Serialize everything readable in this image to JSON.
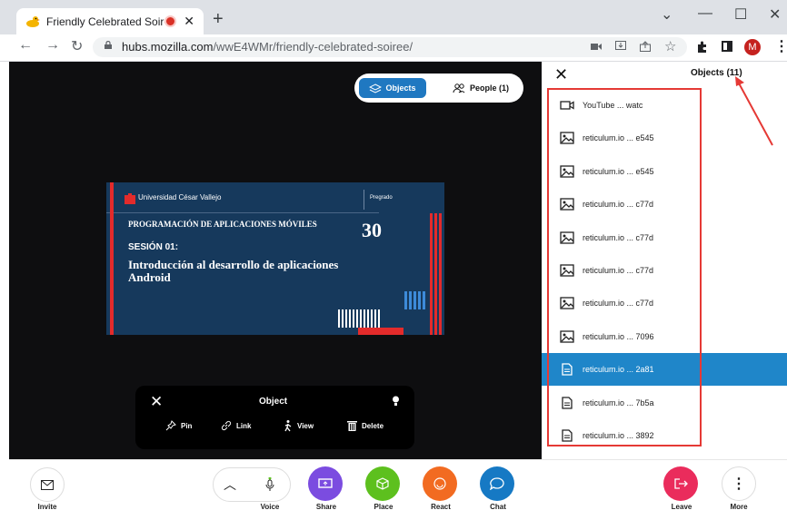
{
  "browser": {
    "tab_title": "Friendly Celebrated Soiree | ",
    "tab_close": "✕",
    "new_tab": "+",
    "win_minimize": "—",
    "win_maximize": "☐",
    "win_close": "✕",
    "url_domain": "hubs.mozilla.com",
    "url_path": "/wwE4WMr/friendly-celebrated-soiree/",
    "avatar_letter": "M"
  },
  "toggle": {
    "objects_label": "Objects",
    "people_label": "People (1)"
  },
  "slide": {
    "university": "Universidad César Vallejo",
    "program": "Pregrado",
    "course": "PROGRAMACIÓN DE APLICACIONES MÓVILES",
    "anniv": "30",
    "session": "SESIÓN 01:",
    "intro": "Introducción al desarrollo de aplicaciones Android"
  },
  "object_menu": {
    "title": "Object",
    "actions": [
      "Pin",
      "Link",
      "View",
      "Delete"
    ]
  },
  "panel": {
    "title": "Objects (11)",
    "items": [
      {
        "label": "YouTube ... watc",
        "icon": "video-icon"
      },
      {
        "label": "reticulum.io ... e545",
        "icon": "image-icon"
      },
      {
        "label": "reticulum.io ... e545",
        "icon": "image-icon"
      },
      {
        "label": "reticulum.io ... c77d",
        "icon": "image-icon"
      },
      {
        "label": "reticulum.io ... c77d",
        "icon": "image-icon"
      },
      {
        "label": "reticulum.io ... c77d",
        "icon": "image-icon"
      },
      {
        "label": "reticulum.io ... c77d",
        "icon": "image-icon"
      },
      {
        "label": "reticulum.io ... 7096",
        "icon": "image-icon"
      },
      {
        "label": "reticulum.io ... 2a81",
        "icon": "document-icon",
        "selected": true
      },
      {
        "label": "reticulum.io ... 7b5a",
        "icon": "document-icon"
      },
      {
        "label": "reticulum.io ... 3892",
        "icon": "document-icon"
      }
    ]
  },
  "toolbar": {
    "invite": "Invite",
    "voice": "Voice",
    "share": "Share",
    "place": "Place",
    "react": "React",
    "chat": "Chat",
    "leave": "Leave",
    "more": "More"
  },
  "colors": {
    "accent": "#1f78c1",
    "selected_row": "#1f86c9",
    "share": "#7b4ce0",
    "place": "#5dc01e",
    "react": "#f26b21",
    "chat": "#1679c4",
    "leave": "#ea2c5c",
    "annotation": "#e53935"
  }
}
